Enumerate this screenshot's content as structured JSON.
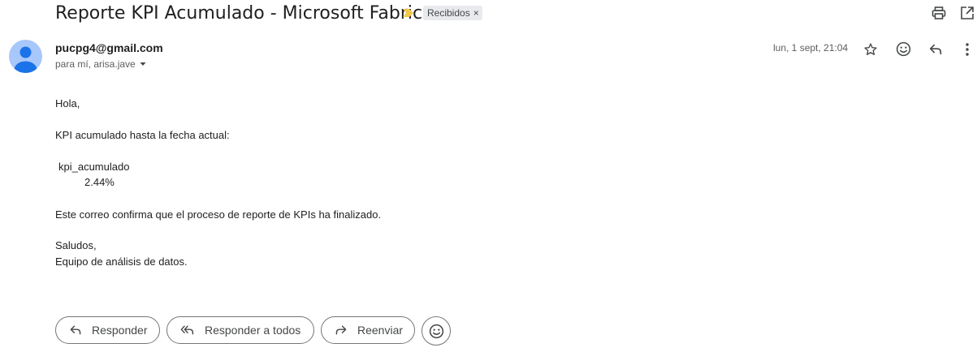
{
  "header": {
    "subject": "Reporte KPI Acumulado - Microsoft Fabric",
    "label": "Recibidos",
    "label_remove": "×",
    "importance_color": "#f2c94c",
    "icons": [
      "importance-marker-icon",
      "print-icon",
      "open-in-new-window-icon"
    ]
  },
  "message": {
    "sender": "pucpg4@gmail.com",
    "recipients": "para mí, arisa.jave",
    "date": "lun, 1 sept, 21:04",
    "icons": [
      "star-icon",
      "emoji-reaction-icon",
      "reply-icon",
      "more-vert-icon"
    ]
  },
  "body": {
    "greeting": "Hola,",
    "intro": "KPI acumulado hasta la fecha actual:",
    "table_header": "kpi_acumulado",
    "table_value": "2.44%",
    "confirmation": "Este correo confirma que el proceso de reporte de KPIs ha finalizado.",
    "closing": "Saludos,",
    "signature": "Equipo de análisis de datos."
  },
  "actions": {
    "reply": "Responder",
    "reply_all": "Responder a todos",
    "forward": "Reenviar",
    "icons": [
      "reply-icon",
      "reply-all-icon",
      "forward-icon",
      "emoji-icon"
    ]
  },
  "colors": {
    "avatar_bg": "#a8c7fa",
    "avatar_fg": "#1a73e8",
    "chip_bg": "#e8eaed"
  }
}
